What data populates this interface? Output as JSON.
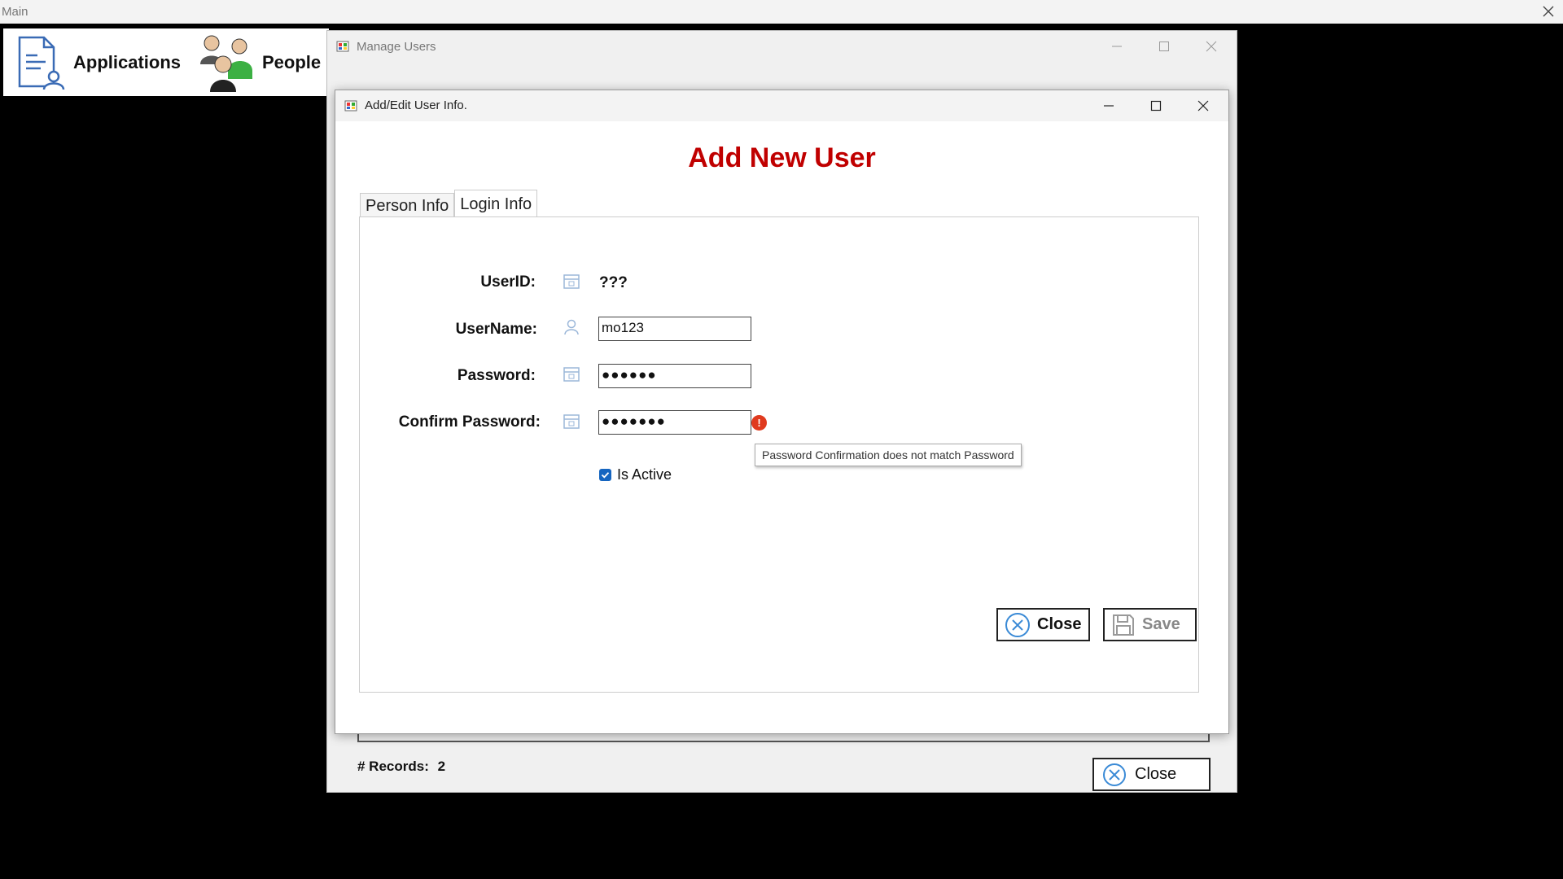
{
  "main": {
    "title": "Main",
    "toolbar": [
      {
        "label": "Applications",
        "icon": "applications-icon"
      },
      {
        "label": "People",
        "icon": "people-icon"
      }
    ]
  },
  "manage_users": {
    "title": "Manage Users",
    "records_label": "# Records:",
    "records_count": "2",
    "close_label": "Close"
  },
  "dialog": {
    "title": "Add/Edit User Info.",
    "heading": "Add New User",
    "tabs": [
      "Person Info",
      "Login Info"
    ],
    "active_tab": "Login Info",
    "fields": {
      "userid_label": "UserID:",
      "userid_value": "???",
      "username_label": "UserName:",
      "username_value": "mo123",
      "password_label": "Password:",
      "password_value": "●●●●●●",
      "confirm_label": "Confirm Password:",
      "confirm_value": "●●●●●●●"
    },
    "error_tooltip": "Password Confirmation does not match Password",
    "is_active_label": "Is Active",
    "is_active": true,
    "close_label": "Close",
    "save_label": "Save"
  },
  "colors": {
    "heading": "#c00000",
    "error": "#e03a1e",
    "checkbox": "#1565c0"
  }
}
